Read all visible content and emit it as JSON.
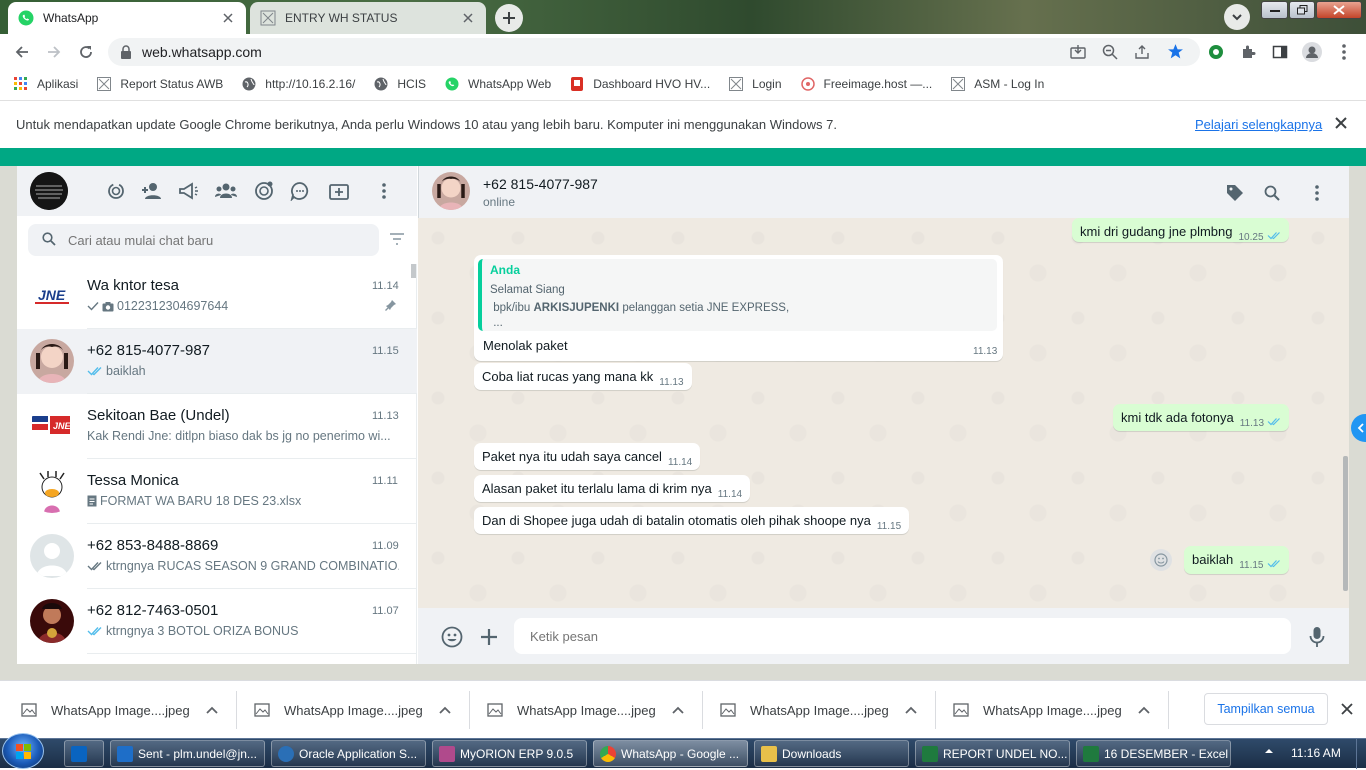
{
  "browser": {
    "tabs": [
      {
        "title": "WhatsApp",
        "active": true
      },
      {
        "title": "ENTRY WH STATUS",
        "active": false
      }
    ],
    "url": "web.whatsapp.com",
    "bookmarks": [
      {
        "label": "Aplikasi",
        "icon": "apps-grid-icon"
      },
      {
        "label": "Report Status AWB",
        "icon": "page-icon"
      },
      {
        "label": "http://10.16.2.16/",
        "icon": "globe-icon"
      },
      {
        "label": "HCIS",
        "icon": "globe-icon"
      },
      {
        "label": "WhatsApp Web",
        "icon": "whatsapp-icon"
      },
      {
        "label": "Dashboard HVO HV...",
        "icon": "dashboard-icon"
      },
      {
        "label": "Login",
        "icon": "page-icon"
      },
      {
        "label": "Freeimage.host —...",
        "icon": "freeimage-icon"
      },
      {
        "label": "ASM - Log In",
        "icon": "page-icon"
      }
    ],
    "infobar": {
      "message": "Untuk mendapatkan update Google Chrome berikutnya, Anda perlu Windows 10 atau yang lebih baru. Komputer ini menggunakan Windows 7.",
      "link": "Pelajari selengkapnya"
    }
  },
  "whatsapp": {
    "search_placeholder": "Cari atau mulai chat baru",
    "chats": [
      {
        "name": "Wa kntor tesa",
        "time": "11.14",
        "preview": "0122312304697644",
        "status": "single-check",
        "has_camera": true,
        "pinned": true,
        "avatar": "jne-logo"
      },
      {
        "name": "+62 815-4077-987",
        "time": "11.15",
        "preview": "baiklah",
        "status": "double-check-read",
        "active": true,
        "avatar": "girl-photo"
      },
      {
        "name": "Sekitoan Bae (Undel)",
        "time": "11.13",
        "preview": "Kak Rendi Jne: ditlpn biaso dak bs jg no penerimo wi...",
        "avatar": "jne-group"
      },
      {
        "name": "Tessa Monica",
        "time": "11.11",
        "preview": "FORMAT WA BARU 18 DES 23.xlsx",
        "doc": true,
        "avatar": "daisy"
      },
      {
        "name": "+62 853-8488-8869",
        "time": "11.09",
        "preview": "ktrngnya RUCAS SEASON 9 GRAND COMBINATIO...",
        "status": "double-check",
        "avatar": "default"
      },
      {
        "name": "+62 812-7463-0501",
        "time": "11.07",
        "preview": "ktrngnya 3 BOTOL ORIZA BONUS",
        "status": "double-check-read",
        "avatar": "dark-photo"
      }
    ],
    "conversation": {
      "name": "+62 815-4077-987",
      "status": "online",
      "messages": [
        {
          "dir": "out",
          "text": "kmi dri gudang jne plmbng",
          "time": "10.25"
        },
        {
          "dir": "in",
          "quote_author": "Anda",
          "quote_line1": "Selamat Siang",
          "quote_line2_pre": " bpk/ibu ",
          "quote_line2_bold": "ARKISJUPENKI",
          "quote_line2_post": " pelanggan setia JNE EXPRESS,",
          "quote_line3": " ...",
          "text": "Menolak paket",
          "time": "11.13"
        },
        {
          "dir": "in",
          "text": "Coba liat rucas yang mana kk",
          "time": "11.13"
        },
        {
          "dir": "out",
          "text": "kmi tdk ada fotonya",
          "time": "11.13"
        },
        {
          "dir": "in",
          "text": "Paket nya itu udah saya cancel",
          "time": "11.14"
        },
        {
          "dir": "in",
          "text": "Alasan paket itu terlalu lama di krim nya",
          "time": "11.14"
        },
        {
          "dir": "in",
          "text": "Dan di Shopee juga udah di batalin otomatis oleh pihak shoope nya",
          "time": "11.15"
        },
        {
          "dir": "out",
          "text": "baiklah",
          "time": "11.15"
        }
      ],
      "composer_placeholder": "Ketik pesan"
    }
  },
  "downloads": {
    "items": [
      "WhatsApp Image....jpeg",
      "WhatsApp Image....jpeg",
      "WhatsApp Image....jpeg",
      "WhatsApp Image....jpeg",
      "WhatsApp Image....jpeg"
    ],
    "show_all": "Tampilkan semua"
  },
  "taskbar": {
    "items": [
      {
        "label": "Sent - plm.undel@jn...",
        "icon_color": "#1e6ec8"
      },
      {
        "label": "Oracle Application S...",
        "icon_color": "#2a6fb6"
      },
      {
        "label": "MyORION ERP 9.0.5",
        "icon_color": "#b04a8c"
      },
      {
        "label": "WhatsApp - Google ...",
        "icon_color": "#e0b12b",
        "active": true
      },
      {
        "label": "Downloads",
        "icon_color": "#e8c04a"
      },
      {
        "label": "REPORT UNDEL NO...",
        "icon_color": "#1f7a3e"
      },
      {
        "label": "16 DESEMBER - Excel",
        "icon_color": "#1f7a3e"
      }
    ],
    "clock": "11:16 AM"
  },
  "colors": {
    "wa_green": "#00a884",
    "bubble_out": "#d9fdd3",
    "read_tick": "#53bdeb",
    "link_blue": "#1a73e8"
  }
}
